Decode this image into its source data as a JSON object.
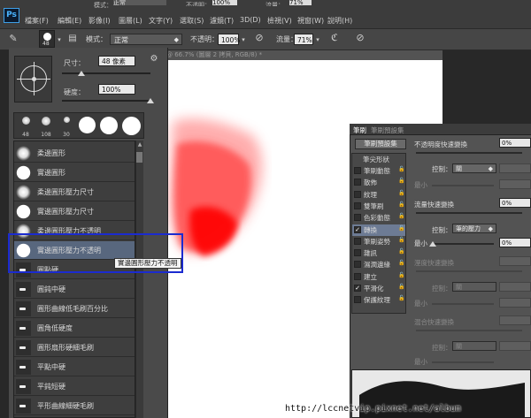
{
  "app": {
    "logo": "Ps"
  },
  "menubar": {
    "items": [
      "檔案(F)",
      "編輯(E)",
      "影像(I)",
      "圖層(L)",
      "文字(Y)",
      "選取(S)",
      "濾鏡(T)",
      "3D(D)",
      "檢視(V)",
      "視窗(W)",
      "說明(H)"
    ],
    "top_row_partial": [
      "模式：",
      "正常",
      "不透明：",
      "100%",
      "流量：",
      "71%"
    ]
  },
  "options_bar": {
    "brush_size": "48",
    "mode_label": "模式：",
    "mode_value": "正常",
    "opacity_label": "不透明：",
    "opacity_value": "100%",
    "flow_label": "流量：",
    "flow_value": "71%",
    "icons": [
      "brush-tool-icon",
      "brush-preset-dropdown-icon",
      "brush-panel-toggle-icon",
      "pressure-opacity-icon",
      "airbrush-icon",
      "pressure-size-icon"
    ]
  },
  "document_tab": {
    "title": "@ 66.7% (圖層 2 拷貝, RGB/8) *"
  },
  "brush_picker": {
    "size_label": "尺寸：",
    "size_value": "48 像素",
    "hardness_label": "硬度：",
    "hardness_value": "100%",
    "size_level_pct": 22,
    "hardness_level_pct": 100,
    "thumbnails": [
      {
        "num": "48",
        "kind": "soft"
      },
      {
        "num": "108",
        "kind": "soft"
      },
      {
        "num": "30",
        "kind": "soft"
      },
      {
        "num": "",
        "kind": "hard"
      },
      {
        "num": "",
        "kind": "hard"
      },
      {
        "num": "",
        "kind": "hard"
      }
    ],
    "items": [
      {
        "label": "柔邊圓形",
        "icon": "soft"
      },
      {
        "label": "實邊圓形",
        "icon": "hard"
      },
      {
        "label": "柔邊圓形壓力尺寸",
        "icon": "soft"
      },
      {
        "label": "實邊圓形壓力尺寸",
        "icon": "hard"
      },
      {
        "label": "柔邊圓形壓力不透明",
        "icon": "soft"
      },
      {
        "label": "實邊圓形壓力不透明",
        "icon": "hard",
        "selected": true
      },
      {
        "label": "圓點硬",
        "icon": "tip"
      },
      {
        "label": "圓鈍中硬",
        "icon": "tip"
      },
      {
        "label": "圓形曲線低毛刷百分比",
        "icon": "tip"
      },
      {
        "label": "圓角低硬度",
        "icon": "tip"
      },
      {
        "label": "圓形扇形硬細毛刷",
        "icon": "tip"
      },
      {
        "label": "平點中硬",
        "icon": "tip"
      },
      {
        "label": "平鈍短硬",
        "icon": "tip"
      },
      {
        "label": "平形曲線細硬毛刷",
        "icon": "tip"
      }
    ],
    "tooltip": "實邊圓形壓力不透明"
  },
  "brush_panel": {
    "tabs": [
      "筆刷",
      "筆刷預設集"
    ],
    "preset_button": "筆刷預設集",
    "section_header": "筆尖形狀",
    "items": [
      {
        "label": "筆刷動態",
        "checked": false,
        "lock": true
      },
      {
        "label": "散佈",
        "checked": false,
        "lock": true
      },
      {
        "label": "紋理",
        "checked": false,
        "lock": true
      },
      {
        "label": "雙筆刷",
        "checked": false,
        "lock": true
      },
      {
        "label": "色彩動態",
        "checked": false,
        "lock": true
      },
      {
        "label": "轉換",
        "checked": true,
        "lock": true,
        "active": true
      },
      {
        "label": "筆刷姿勢",
        "checked": false,
        "lock": true
      },
      {
        "label": "雜訊",
        "checked": false,
        "lock": true
      },
      {
        "label": "濕潤邊緣",
        "checked": false,
        "lock": true
      },
      {
        "label": "建立",
        "checked": false,
        "lock": true
      },
      {
        "label": "平滑化",
        "checked": true,
        "lock": true
      },
      {
        "label": "保護紋理",
        "checked": false,
        "lock": true
      }
    ],
    "opacity_jitter_label": "不透明度快速變換",
    "opacity_jitter_value": "0%",
    "control_label": "控制：",
    "control_off": "關",
    "minimum_label": "最小",
    "flow_jitter_label": "流量快速變換",
    "flow_jitter_value": "0%",
    "control_pen": "筆的壓力",
    "minimum_value": "0%",
    "wetness_label": "溼度快速變換",
    "mix_label": "混合快速變換"
  },
  "watermark": "http://lccnetvip.pixnet.net/album",
  "colors": {
    "accent_highlight": "#1b2bd0",
    "selection": "#58677e",
    "paint": "#ff1a1a"
  }
}
